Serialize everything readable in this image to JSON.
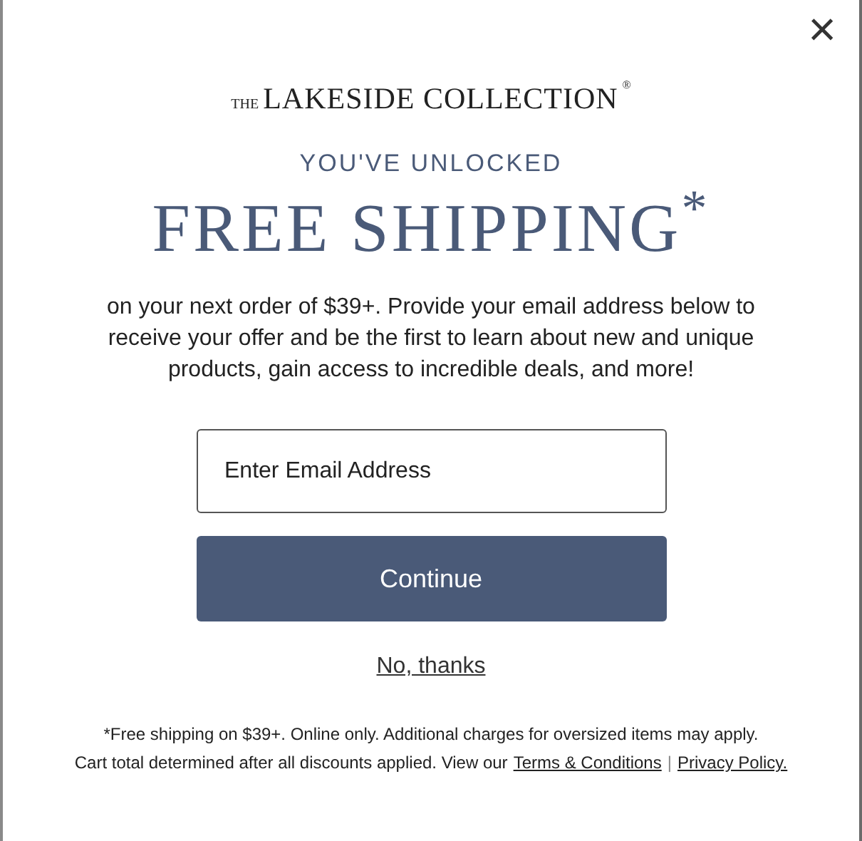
{
  "close_button": {
    "label": "×"
  },
  "logo": {
    "prefix": "THE",
    "name": "LAKESIDE COLLECTION",
    "mark": "®"
  },
  "eyebrow": "YOU'VE UNLOCKED",
  "headline": "FREE SHIPPING$^{*}$",
  "body": "on your next order of $39+. Provide your email address below to receive your offer and be the first to learn about new and unique products, gain access to incredible deals, and more!",
  "email_field": {
    "placeholder": "Enter Email Address"
  },
  "continue_button": "Continue",
  "decline_link": "No, thanks",
  "disclaimer": {
    "line_1": "*Free shipping on $39+. Online only. Additional charges for oversized items may apply.",
    "line_2": "Cart total determined after all discounts applied. View our",
    "links": [
      "Terms & Conditions",
      "Privacy Policy."
    ],
    "separator": "|"
  }
}
